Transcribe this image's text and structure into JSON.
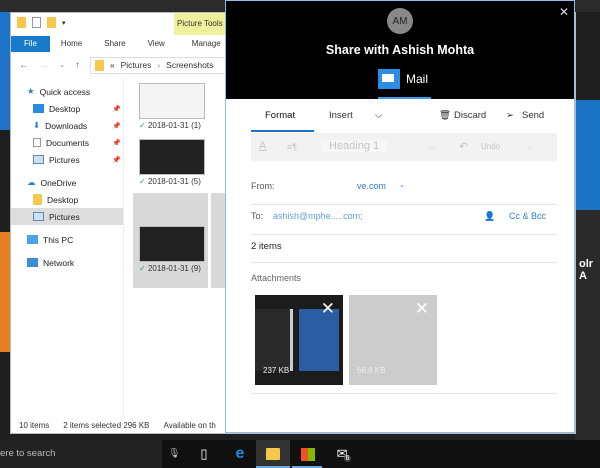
{
  "explorer": {
    "ribbon_tabs": [
      "File",
      "Home",
      "Share",
      "View",
      "Manage"
    ],
    "context_tab": "Picture Tools",
    "breadcrumb": [
      "Pictures",
      "Screenshots"
    ],
    "nav": [
      {
        "label": "Quick access"
      },
      {
        "label": "Desktop",
        "pinned": true
      },
      {
        "label": "Downloads",
        "pinned": true
      },
      {
        "label": "Documents",
        "pinned": true
      },
      {
        "label": "Pictures",
        "pinned": true
      },
      {
        "label": "OneDrive"
      },
      {
        "label": "Desktop"
      },
      {
        "label": "Pictures",
        "selected": true
      },
      {
        "label": "This PC"
      },
      {
        "label": "Network"
      }
    ],
    "files": [
      "2018-01-31 (1)",
      "2018-01-31 (5)",
      "2018-01-31 (9)"
    ],
    "status": {
      "count": "10 items",
      "selected": "2 items selected  296 KB",
      "availability": "Available on th"
    }
  },
  "share": {
    "avatar_initials": "AM",
    "title": "Share with Ashish Mohta",
    "app": "Mail",
    "toolbar": {
      "format": "Format",
      "insert": "Insert",
      "discard": "Discard",
      "send": "Send"
    },
    "format_bar": {
      "style": "Heading 1",
      "undo": "Undo"
    },
    "from_label": "From:",
    "from_value": "ve.com",
    "to_label": "To:",
    "to_value": "ashish@mphe.....com;",
    "cc_bcc": "Cc & Bcc",
    "items": "2 items",
    "attachments_label": "Attachments",
    "attachments": [
      {
        "size": "237 KB"
      },
      {
        "size": "66.8 KB"
      }
    ]
  },
  "desktop": {
    "right_text": "olr A"
  },
  "taskbar": {
    "search_placeholder": "ere to search",
    "mail_badge": "6"
  }
}
